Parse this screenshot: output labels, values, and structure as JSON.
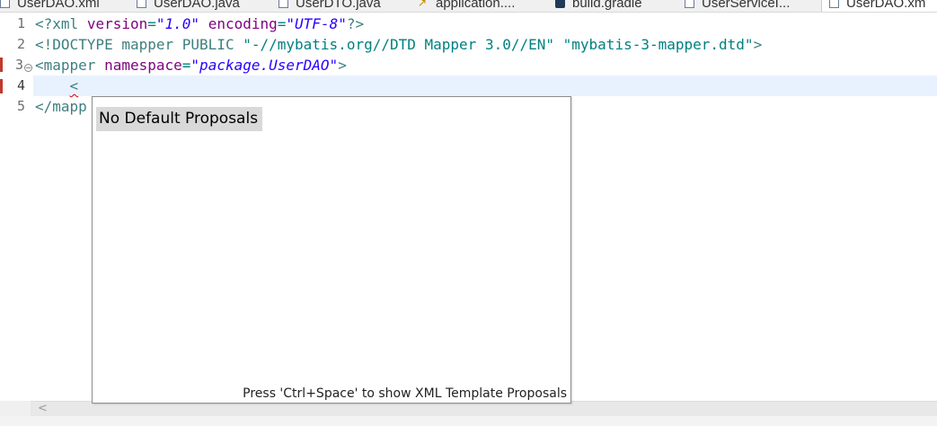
{
  "tabs": [
    {
      "label": "UserDAO.xml",
      "icon": "xml-file-icon",
      "active": false
    },
    {
      "label": "UserDAO.java",
      "icon": "java-file-icon",
      "active": false
    },
    {
      "label": "UserDTO.java",
      "icon": "java-file-icon",
      "active": false
    },
    {
      "label": "application....",
      "icon": "properties-file-icon",
      "active": false
    },
    {
      "label": "build.gradle",
      "icon": "gradle-file-icon",
      "active": false
    },
    {
      "label": "UserServiceI...",
      "icon": "java-file-icon",
      "active": false
    },
    {
      "label": "UserDAO.xm",
      "icon": "xml-file-icon",
      "active": true
    }
  ],
  "editor": {
    "line_numbers": [
      "1",
      "2",
      "3",
      "4",
      "5"
    ],
    "current_line": "4",
    "line1": {
      "open": "<?",
      "tag": "xml",
      "attr1": "version",
      "eq1": "=",
      "val1": "\"1.0\"",
      "attr2": "encoding",
      "eq2": "=",
      "val2": "\"UTF-8\"",
      "close": "?>"
    },
    "line2": {
      "open": "<!",
      "keyword": "DOCTYPE",
      "name": "mapper",
      "public": "PUBLIC",
      "public_id": "\"-//mybatis.org//DTD Mapper 3.0//EN\"",
      "system_id": "\"mybatis-3-mapper.dtd\"",
      "close": ">"
    },
    "line3": {
      "open": "<",
      "tag": "mapper",
      "attr": "namespace",
      "eq": "=",
      "val": "\"package.UserDAO\"",
      "close": ">"
    },
    "line4": {
      "indent": "    ",
      "text": "<"
    },
    "line5": {
      "text": "</mapp"
    },
    "fold_icon": "collapse-fold-icon"
  },
  "content_assist": {
    "proposal": "No Default Proposals",
    "status": "Press 'Ctrl+Space' to show XML Template Proposals"
  },
  "scrollbar": {
    "left_arrow": "<"
  },
  "colors": {
    "current_line_bg": "#e8f2fe",
    "tag": "#3f7f7f",
    "attribute": "#7f007f",
    "string": "#2a00ff",
    "error_marker": "#c0392b"
  }
}
